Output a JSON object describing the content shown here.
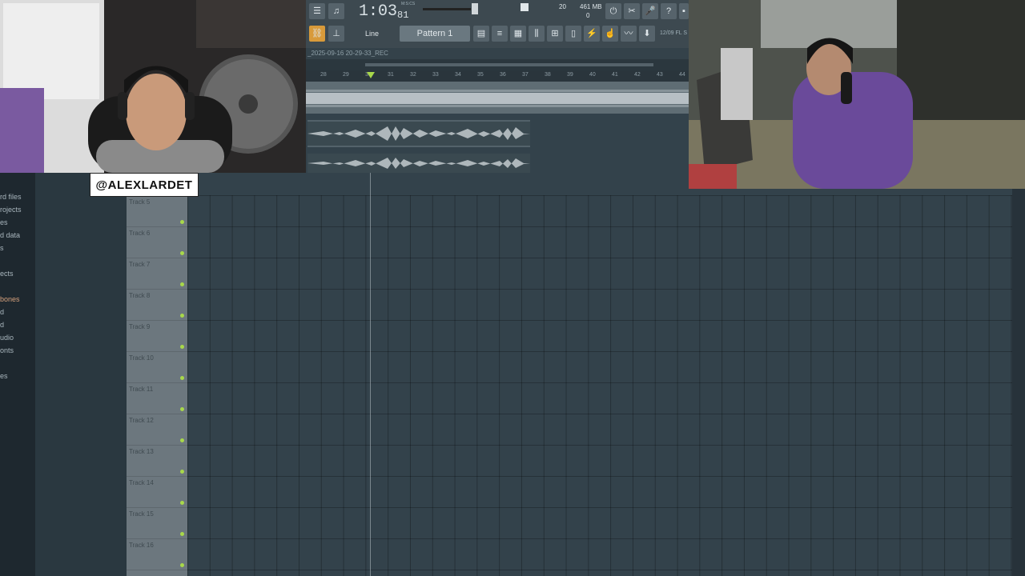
{
  "browser": {
    "items": [
      {
        "label": "rd files",
        "highlight": false
      },
      {
        "label": "rojects",
        "highlight": false
      },
      {
        "label": "es",
        "highlight": false
      },
      {
        "label": "d data",
        "highlight": false
      },
      {
        "label": "s",
        "highlight": false
      },
      {
        "label": "ects",
        "highlight": false
      },
      {
        "label": "bones",
        "highlight": true
      },
      {
        "label": "d",
        "highlight": false
      },
      {
        "label": "d",
        "highlight": false
      },
      {
        "label": "udio",
        "highlight": false
      },
      {
        "label": "onts",
        "highlight": false
      },
      {
        "label": "es",
        "highlight": false
      }
    ]
  },
  "playlist": {
    "tracks": [
      "Track 5",
      "Track 6",
      "Track 7",
      "Track 8",
      "Track 9",
      "Track 10",
      "Track 11",
      "Track 12",
      "Track 13",
      "Track 14",
      "Track 15",
      "Track 16"
    ],
    "title": "_2025-09-16 20-29-33_REC",
    "ruler_numbers": [
      "28",
      "29",
      "30",
      "31",
      "32",
      "33",
      "34",
      "35",
      "36",
      "37",
      "38",
      "39",
      "40",
      "41",
      "42",
      "43",
      "44"
    ]
  },
  "toolbar": {
    "time": "1:03",
    "time_small": "81",
    "time_unit": "M:S:CS",
    "pattern": "Pattern 1",
    "snap": "Line",
    "cpu": "20",
    "memory": "461 MB",
    "voices": "0",
    "date": "12/09  FL S"
  },
  "overlay": {
    "handle": "@ALEXLARDET"
  },
  "colors": {
    "accent": "#a8d84a",
    "track_header": "#6c777e",
    "grid": "#33424b"
  }
}
